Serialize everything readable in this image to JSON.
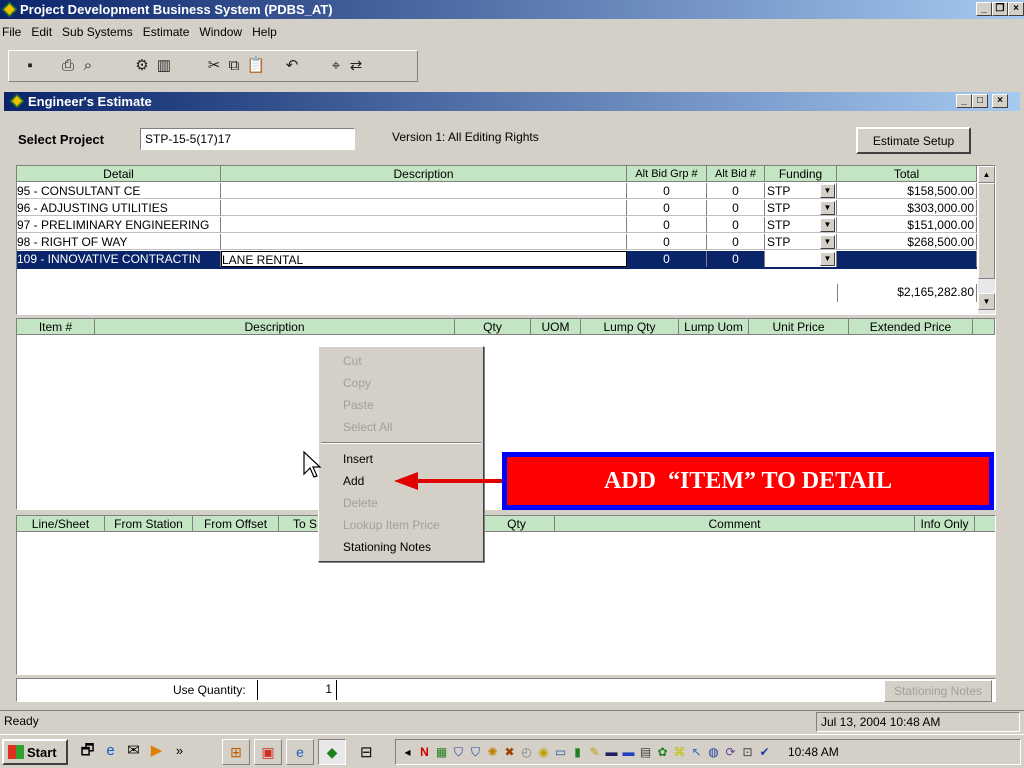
{
  "app": {
    "title": "Project Development Business System (PDBS_AT)"
  },
  "menubar": [
    "File",
    "Edit",
    "Sub Systems",
    "Estimate",
    "Window",
    "Help"
  ],
  "toolbar": {
    "icons": [
      "save-icon",
      "print-icon",
      "print-preview-icon",
      "tools-icon",
      "columns-icon",
      "cut-icon",
      "copy-icon",
      "paste-icon",
      "undo-icon",
      "find-icon",
      "find-replace-icon"
    ]
  },
  "child_window": {
    "title": "Engineer's Estimate"
  },
  "project": {
    "label": "Select Project",
    "value": "STP-15-5(17)17",
    "version": "Version 1: All Editing Rights",
    "setup_button": "Estimate Setup"
  },
  "detail_grid": {
    "headers": [
      "Detail",
      "Description",
      "Alt Bid Grp #",
      "Alt Bid #",
      "Funding",
      "Total"
    ],
    "rows": [
      {
        "detail": "95 - CONSULTANT CE",
        "description": "",
        "alt_grp": "0",
        "alt_bid": "0",
        "funding": "STP",
        "total": "$158,500.00"
      },
      {
        "detail": "96 - ADJUSTING UTILITIES",
        "description": "",
        "alt_grp": "0",
        "alt_bid": "0",
        "funding": "STP",
        "total": "$303,000.00"
      },
      {
        "detail": "97 - PRELIMINARY ENGINEERING",
        "description": "",
        "alt_grp": "0",
        "alt_bid": "0",
        "funding": "STP",
        "total": "$151,000.00"
      },
      {
        "detail": "98 - RIGHT OF WAY",
        "description": "",
        "alt_grp": "0",
        "alt_bid": "0",
        "funding": "STP",
        "total": "$268,500.00"
      },
      {
        "detail": "109 - INNOVATIVE CONTRACTIN",
        "description": "LANE RENTAL",
        "alt_grp": "0",
        "alt_bid": "0",
        "funding": "",
        "total": ""
      }
    ],
    "grand_total": "$2,165,282.80"
  },
  "item_grid": {
    "headers": [
      "Item #",
      "Description",
      "Qty",
      "UOM",
      "Lump Qty",
      "Lump Uom",
      "Unit Price",
      "Extended Price"
    ]
  },
  "station_grid": {
    "headers": [
      "Line/Sheet",
      "From Station",
      "From Offset",
      "To S",
      "Qty",
      "Comment",
      "Info Only"
    ]
  },
  "bottom": {
    "use_quantity_label": "Use Quantity:",
    "use_quantity_value": "1",
    "stationing_notes_button": "Stationing Notes"
  },
  "context_menu": {
    "items": [
      {
        "label": "Cut",
        "enabled": false
      },
      {
        "label": "Copy",
        "enabled": false
      },
      {
        "label": "Paste",
        "enabled": false
      },
      {
        "label": "Select All",
        "enabled": false
      },
      {
        "separator": true
      },
      {
        "label": "Insert",
        "enabled": true
      },
      {
        "label": "Add",
        "enabled": true
      },
      {
        "label": "Delete",
        "enabled": false
      },
      {
        "label": "Lookup Item Price",
        "enabled": false
      },
      {
        "label": "Stationing Notes",
        "enabled": true
      }
    ]
  },
  "callout": {
    "text": "ADD  “ITEM” TO DETAIL",
    "color": "#ff0000",
    "border": "#0000ff"
  },
  "statusbar": {
    "status": "Ready",
    "datetime": "Jul 13, 2004 10:48 AM"
  },
  "taskbar": {
    "start": "Start",
    "clock": "10:48 AM"
  },
  "colors": {
    "title_start": "#0a246a",
    "title_end": "#a6caf0",
    "grid_header": "#c4e5c4",
    "selected_row": "#0a246a",
    "arrow": "#e00000"
  }
}
